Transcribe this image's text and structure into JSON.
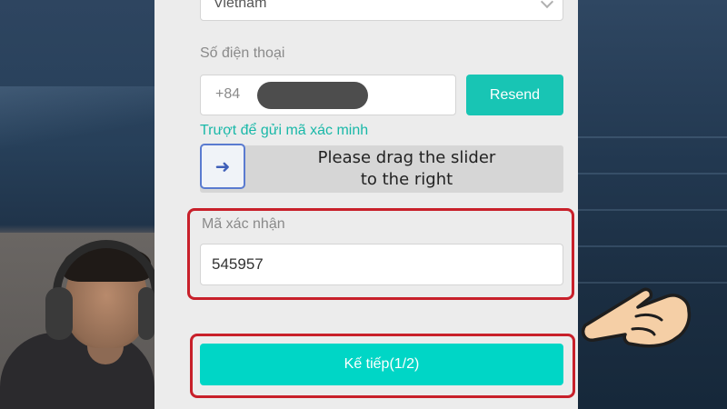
{
  "form": {
    "country": {
      "value": "Vietnam"
    },
    "phone": {
      "label": "Số điện thoại",
      "prefix": "+84",
      "resend_label": "Resend"
    },
    "slider": {
      "hint": "Trượt để gửi mã xác minh",
      "arrow": "➜",
      "text_line1": "Please drag the slider",
      "text_line2": "to the right"
    },
    "verification": {
      "label": "Mã xác nhận",
      "value": "545957"
    },
    "next_label": "Kế tiếp(1/2)"
  },
  "colors": {
    "accent": "#18c5b4",
    "highlight": "#c8202a",
    "slider_border": "#5a7bd0"
  },
  "icons": {
    "pointer": "pointing-hand-icon",
    "select": "chevron-down-icon",
    "slider": "arrow-right-icon"
  }
}
